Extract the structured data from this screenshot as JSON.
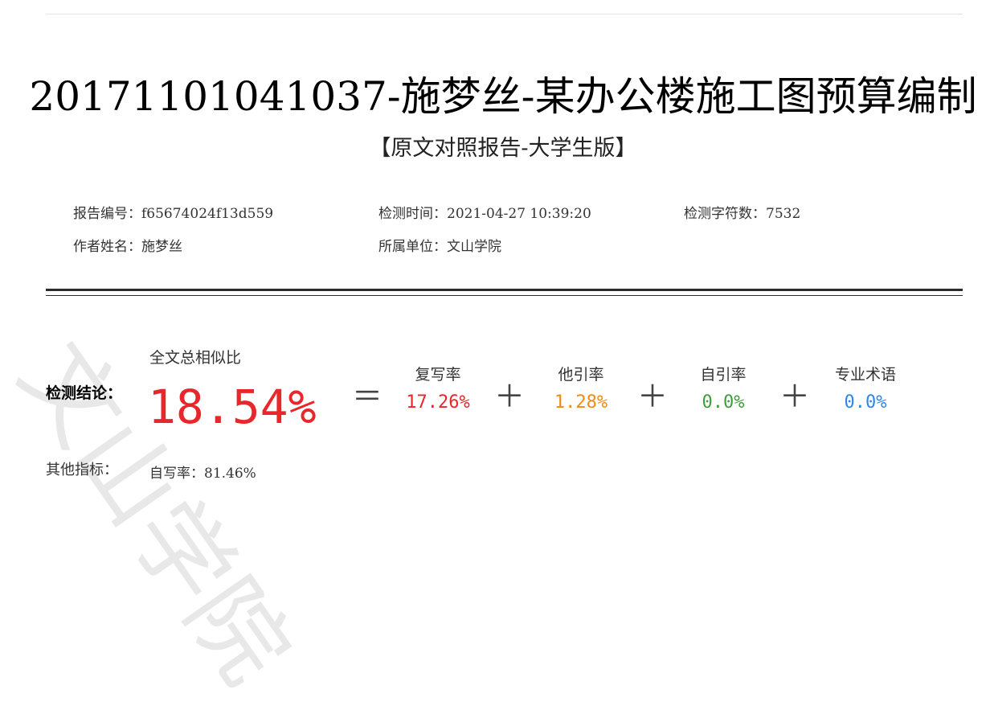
{
  "report": {
    "title": "20171101041037-施梦丝-某办公楼施工图预算编制",
    "subtitle": "【原文对照报告-大学生版】"
  },
  "meta": {
    "report_id_label": "报告编号：",
    "report_id": "f65674024f13d559",
    "check_time_label": "检测时间：",
    "check_time": "2021-04-27 10:39:20",
    "char_count_label": "检测字符数：",
    "char_count": "7532",
    "author_label": "作者姓名：",
    "author": "施梦丝",
    "institution_label": "所属单位：",
    "institution": "文山学院"
  },
  "watermark": "文山学院",
  "conclusion": {
    "label": "检测结论：",
    "total_label": "全文总相似比",
    "total_value": "18.54%",
    "total_color": "#e8262b",
    "operators": {
      "equals": "＝",
      "plus": "＋"
    },
    "metrics": [
      {
        "label": "复写率",
        "value": "17.26%",
        "color": "#e8262b"
      },
      {
        "label": "他引率",
        "value": "1.28%",
        "color": "#f08a12"
      },
      {
        "label": "自引率",
        "value": "0.0%",
        "color": "#3ba03b"
      },
      {
        "label": "专业术语",
        "value": "0.0%",
        "color": "#2f86e6"
      }
    ]
  },
  "other": {
    "label": "其他指标：",
    "self_write_label": "自写率：",
    "self_write_value": "81.46%"
  }
}
